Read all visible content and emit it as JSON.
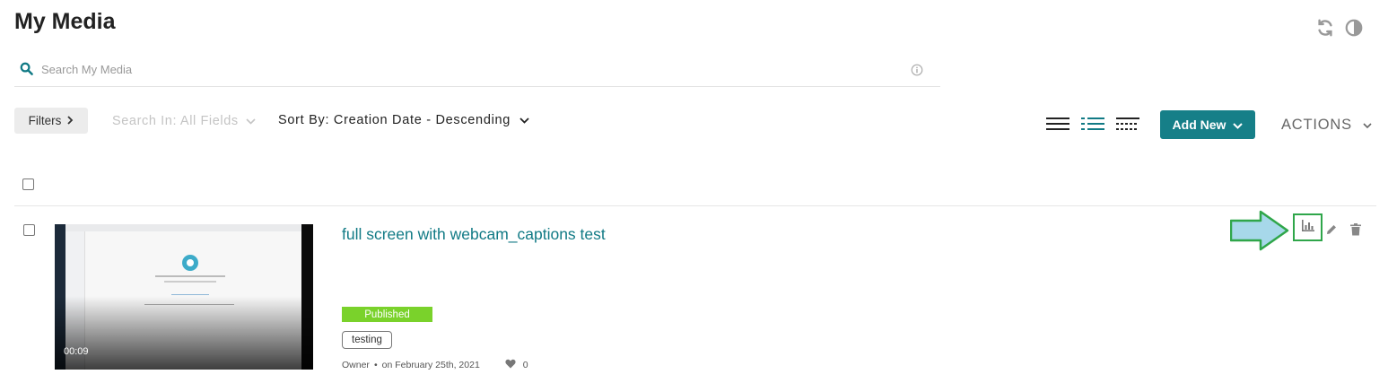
{
  "page": {
    "title": "My Media"
  },
  "header_icons": [
    "refresh-icon",
    "contrast-icon"
  ],
  "search": {
    "placeholder": "Search My Media",
    "value": ""
  },
  "toolbar": {
    "filters_label": "Filters",
    "search_in_label": "Search In: All Fields",
    "sort_by_label": "Sort By: Creation Date - Descending",
    "views": [
      "details-view",
      "list-view",
      "collapsed-view"
    ],
    "active_view": "list-view",
    "add_new_label": "Add New",
    "actions_label": "ACTIONS"
  },
  "colors": {
    "accent": "#167f88",
    "link": "#117a85",
    "published": "#7ad22b",
    "highlight": "#2fa64a",
    "arrow_fill": "#a7d8ea"
  },
  "entries": [
    {
      "title": "full screen with webcam_captions test",
      "duration": "00:09",
      "status": "Published",
      "tags": [
        "testing"
      ],
      "owner": "Owner",
      "date": "on February 25th, 2021",
      "likes": "0",
      "actions": [
        "analytics-icon",
        "edit-icon",
        "delete-icon"
      ]
    }
  ]
}
